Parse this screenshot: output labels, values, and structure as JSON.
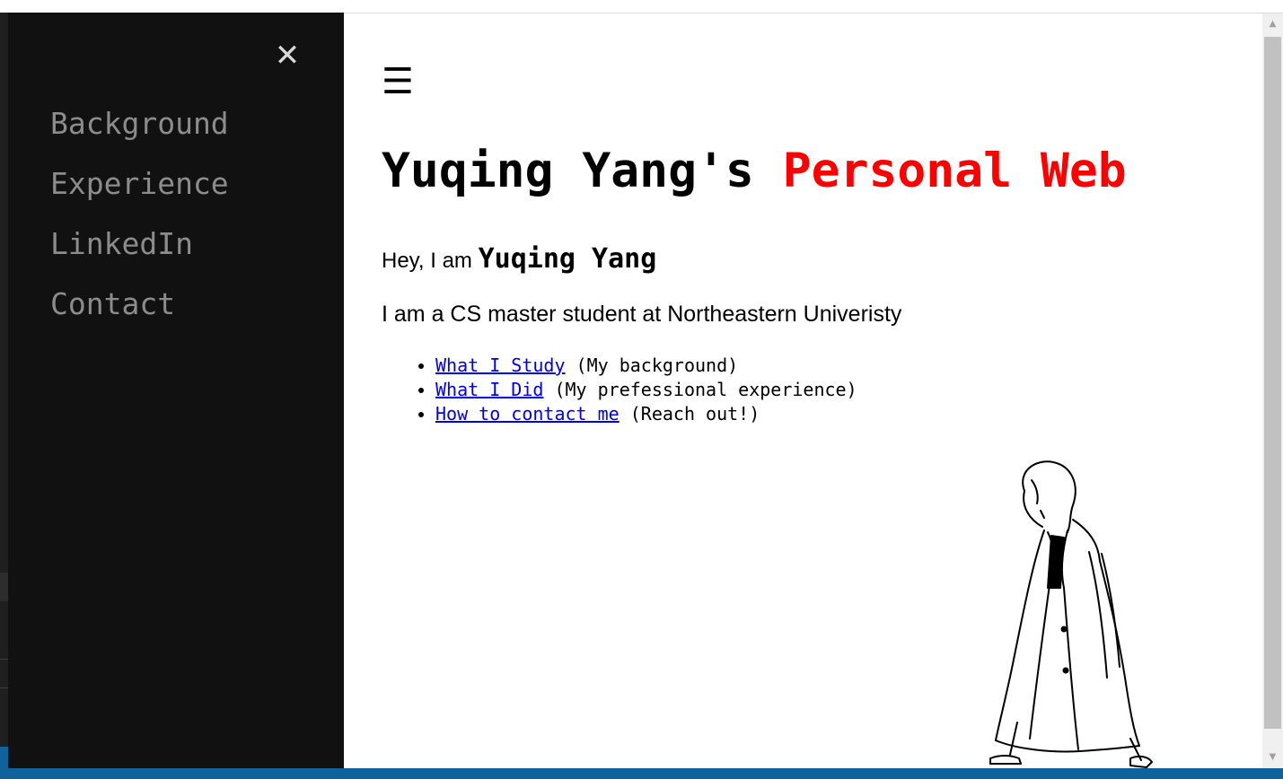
{
  "sidebar": {
    "close_icon": "✕",
    "items": [
      {
        "label": "Background"
      },
      {
        "label": "Experience"
      },
      {
        "label": "LinkedIn"
      },
      {
        "label": "Contact"
      }
    ]
  },
  "main": {
    "menu_icon": "☰",
    "title_part1": "Yuqing Yang's",
    "title_part2": "Personal Web",
    "intro_prefix": "Hey, I am",
    "intro_name": "Yuqing Yang",
    "degree": "I am a CS master student at Northeastern Univeristy",
    "links": [
      {
        "text": "What I Study",
        "note": "(My background)"
      },
      {
        "text": "What I Did",
        "note": "(My prefessional experience)"
      },
      {
        "text": "How to contact me",
        "note": "(Reach out!)"
      }
    ]
  },
  "colors": {
    "sidebar_bg": "#111111",
    "sidebar_text": "#8c8c8c",
    "title_accent": "#ff0000",
    "link": "#0000ee",
    "statusbar": "#0e639c"
  },
  "icons": {
    "close": "close-icon",
    "menu": "hamburger-menu-icon",
    "scroll_up": "chevron-up-icon",
    "scroll_down": "chevron-down-icon",
    "illustration": "walking-woman-illustration"
  },
  "scrollbar": {
    "up_glyph": "▲",
    "down_glyph": "▼"
  }
}
